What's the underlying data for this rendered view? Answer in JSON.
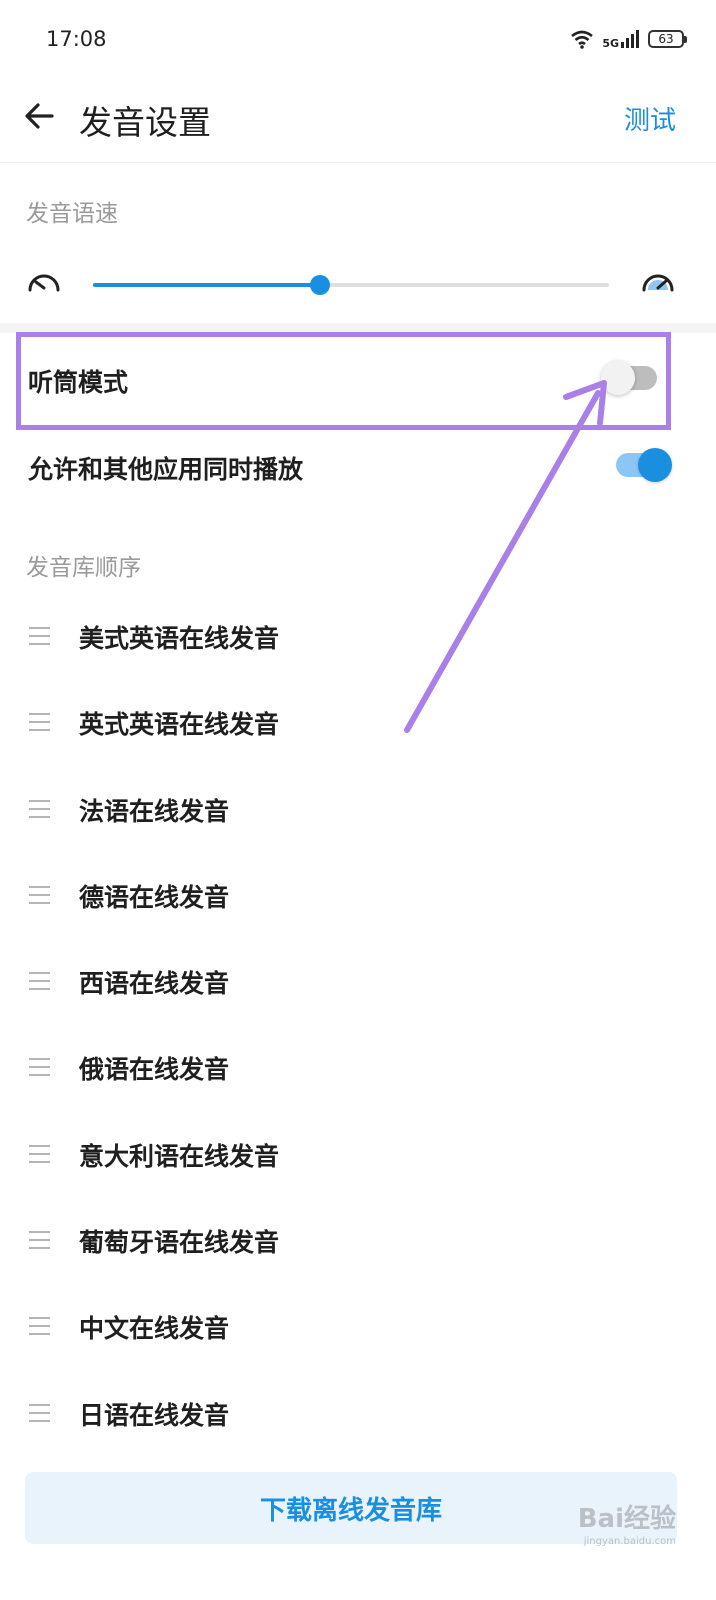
{
  "status_bar": {
    "time": "17:08",
    "network": "5G",
    "battery": "63",
    "icons": [
      "wifi-icon",
      "cellular-signal-icon",
      "battery-icon"
    ]
  },
  "header": {
    "title": "发音设置",
    "action": "测试",
    "back_icon": "arrow-left-icon"
  },
  "speed": {
    "label": "发音语速",
    "slider_value_fraction": 0.44,
    "min_icon": "slow-speedometer-icon",
    "max_icon": "fast-speedometer-icon"
  },
  "toggles": [
    {
      "label": "听筒模式",
      "on": false
    },
    {
      "label": "允许和其他应用同时播放",
      "on": true
    }
  ],
  "library": {
    "label": "发音库顺序",
    "items": [
      "美式英语在线发音",
      "英式英语在线发音",
      "法语在线发音",
      "德语在线发音",
      "西语在线发音",
      "俄语在线发音",
      "意大利语在线发音",
      "葡萄牙语在线发音",
      "中文在线发音",
      "日语在线发音"
    ]
  },
  "download_button": "下载离线发音库",
  "watermark": {
    "text": "Bai经验",
    "sub": "jingyan.baidu.com"
  },
  "colors": {
    "accent": "#1a8fe0",
    "annotation": "#a97fe8",
    "toggle_off": "#bdbdbd",
    "section_label": "#9a9a9a"
  }
}
